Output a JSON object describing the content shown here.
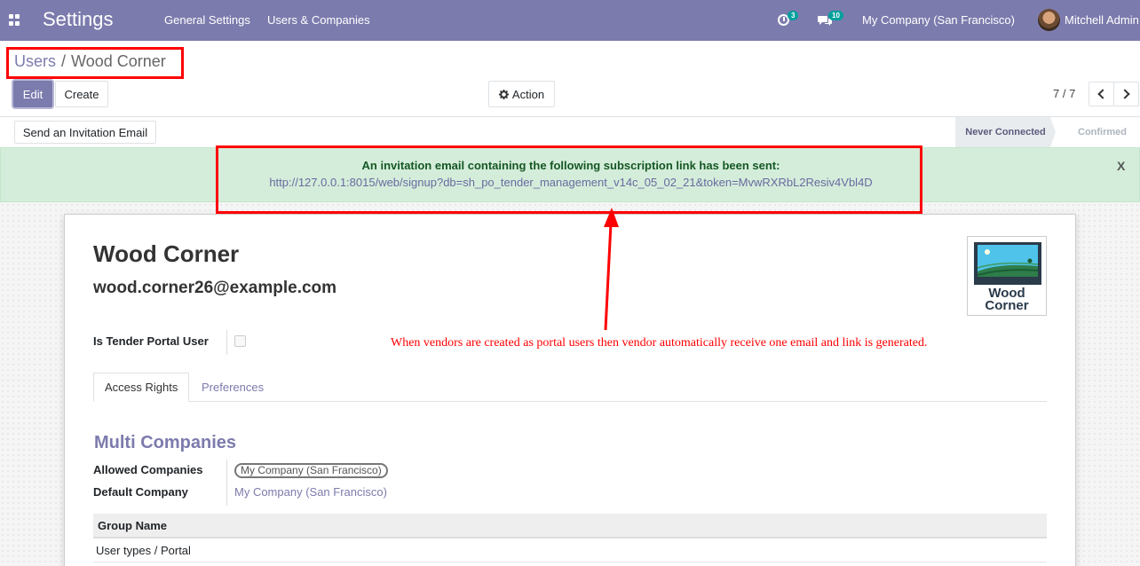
{
  "navbar": {
    "app_name": "Settings",
    "menus": [
      "General Settings",
      "Users & Companies"
    ],
    "activity_count": "3",
    "message_count": "10",
    "company": "My Company (San Francisco)",
    "user": "Mitchell Admin",
    "color": "#7c7bad"
  },
  "breadcrumb": {
    "parent": "Users",
    "separator": "/",
    "current": "Wood Corner"
  },
  "buttons": {
    "edit": "Edit",
    "create": "Create",
    "action": "Action",
    "invite": "Send an Invitation Email"
  },
  "pager": {
    "value": "7 / 7"
  },
  "statusbar": {
    "states": [
      "Never Connected",
      "Confirmed"
    ],
    "current": "Never Connected"
  },
  "alert": {
    "title": "An invitation email containing the following subscription link has been sent:",
    "link": "http://127.0.0.1:8015/web/signup?db=sh_po_tender_management_v14c_05_02_21&token=MvwRXRbL2Resiv4Vbl4D",
    "close": "X"
  },
  "record": {
    "name": "Wood Corner",
    "email": "wood.corner26@example.com",
    "logo_text": [
      "Wood",
      "Corner"
    ],
    "is_tender_portal_user_label": "Is Tender Portal User",
    "is_tender_portal_user": false
  },
  "annotation": {
    "note": "When vendors are created as portal users then vendor automatically receive one email and link is generated.",
    "color": "#ff0000"
  },
  "tabs": [
    {
      "label": "Access Rights",
      "active": true
    },
    {
      "label": "Preferences",
      "active": false
    }
  ],
  "access_rights": {
    "section_title": "Multi Companies",
    "allowed_companies_label": "Allowed Companies",
    "allowed_companies": [
      "My Company (San Francisco)"
    ],
    "default_company_label": "Default Company",
    "default_company": "My Company (San Francisco)",
    "groups_header": "Group Name",
    "groups": [
      "User types / Portal"
    ]
  }
}
